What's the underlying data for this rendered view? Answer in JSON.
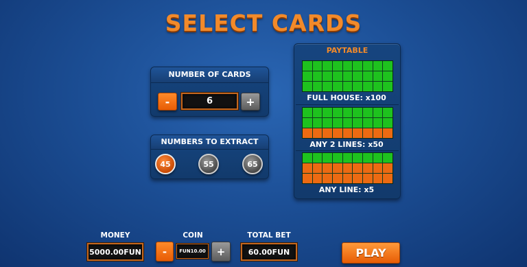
{
  "title": "SELECT CARDS",
  "number_of_cards": {
    "label": "NUMBER OF CARDS",
    "minus": "-",
    "value": "6",
    "plus": "+"
  },
  "numbers_to_extract": {
    "label": "NUMBERS TO EXTRACT",
    "options": [
      "45",
      "55",
      "65"
    ],
    "selected": "45"
  },
  "paytable": {
    "label": "PAYTABLE",
    "prizes": [
      "FULL HOUSE: x100",
      "ANY 2 LINES: x50",
      "ANY LINE: x5"
    ]
  },
  "bottom": {
    "money_label": "MONEY",
    "money_value": "5000.00FUN",
    "coin_label": "COIN",
    "coin_minus": "-",
    "coin_value": "FUN10.00",
    "coin_plus": "+",
    "total_bet_label": "TOTAL BET",
    "total_bet_value": "60.00FUN",
    "play_label": "PLAY"
  },
  "colors": {
    "accent": "#f28a2a",
    "marked": "#1ec21e",
    "unmarked": "#ec6a12",
    "background": "#1c4f96"
  }
}
